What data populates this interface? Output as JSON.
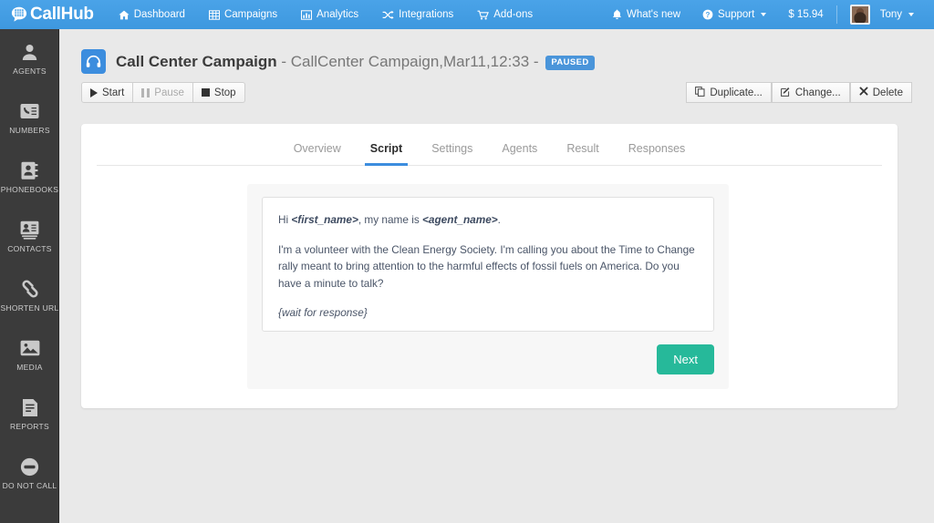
{
  "topnav": {
    "brand": "CallHub",
    "brand_icon": "speech-bubble-keypad-logo",
    "items": [
      {
        "label": "Dashboard",
        "icon": "home-icon"
      },
      {
        "label": "Campaigns",
        "icon": "table-icon"
      },
      {
        "label": "Analytics",
        "icon": "bar-chart-icon"
      },
      {
        "label": "Integrations",
        "icon": "shuffle-icon"
      },
      {
        "label": "Add-ons",
        "icon": "cart-icon"
      }
    ],
    "right": {
      "whats_new": "What's new",
      "whats_new_icon": "bell-icon",
      "support": "Support",
      "support_icon": "question-circle-icon",
      "balance": "$ 15.94",
      "user": "Tony",
      "avatar_icon": "user-avatar"
    }
  },
  "sidebar": {
    "items": [
      {
        "label": "AGENTS",
        "icon": "user-icon"
      },
      {
        "label": "NUMBERS",
        "icon": "phone-list-icon"
      },
      {
        "label": "PHONEBOOKS",
        "icon": "address-book-icon"
      },
      {
        "label": "CONTACTS",
        "icon": "contact-card-icon"
      },
      {
        "label": "SHORTEN URL",
        "icon": "link-icon"
      },
      {
        "label": "MEDIA",
        "icon": "image-icon"
      },
      {
        "label": "REPORTS",
        "icon": "document-lines-icon"
      },
      {
        "label": "DO NOT CALL",
        "icon": "block-icon"
      }
    ]
  },
  "campaign": {
    "icon": "headset-icon",
    "title": "Call Center Campaign",
    "subtitle": "- CallCenter Campaign,Mar11,12:33 -",
    "status": "PAUSED",
    "status_color": "#4a95da"
  },
  "toolbar": {
    "start": "Start",
    "pause": "Pause",
    "stop": "Stop",
    "duplicate": "Duplicate...",
    "change": "Change...",
    "delete": "Delete",
    "start_icon": "play-icon",
    "pause_icon": "pause-icon",
    "stop_icon": "stop-icon",
    "duplicate_icon": "copy-icon",
    "change_icon": "pencil-square-icon",
    "delete_icon": "x-icon"
  },
  "tabs": [
    {
      "label": "Overview",
      "active": false
    },
    {
      "label": "Script",
      "active": true
    },
    {
      "label": "Settings",
      "active": false
    },
    {
      "label": "Agents",
      "active": false
    },
    {
      "label": "Result",
      "active": false
    },
    {
      "label": "Responses",
      "active": false
    }
  ],
  "script": {
    "greeting_pre": "Hi ",
    "greeting_ph1": "<first_name>",
    "greeting_mid": ", my name is ",
    "greeting_ph2": "<agent_name>",
    "greeting_post": ".",
    "body": "I'm a volunteer with the Clean Energy Society. I'm calling you about the Time to Change rally meant to bring attention to the harmful effects of fossil fuels on America. Do you have a minute to talk?",
    "wait": "{wait for response}",
    "next_label": "Next",
    "next_color": "#26b99a"
  }
}
